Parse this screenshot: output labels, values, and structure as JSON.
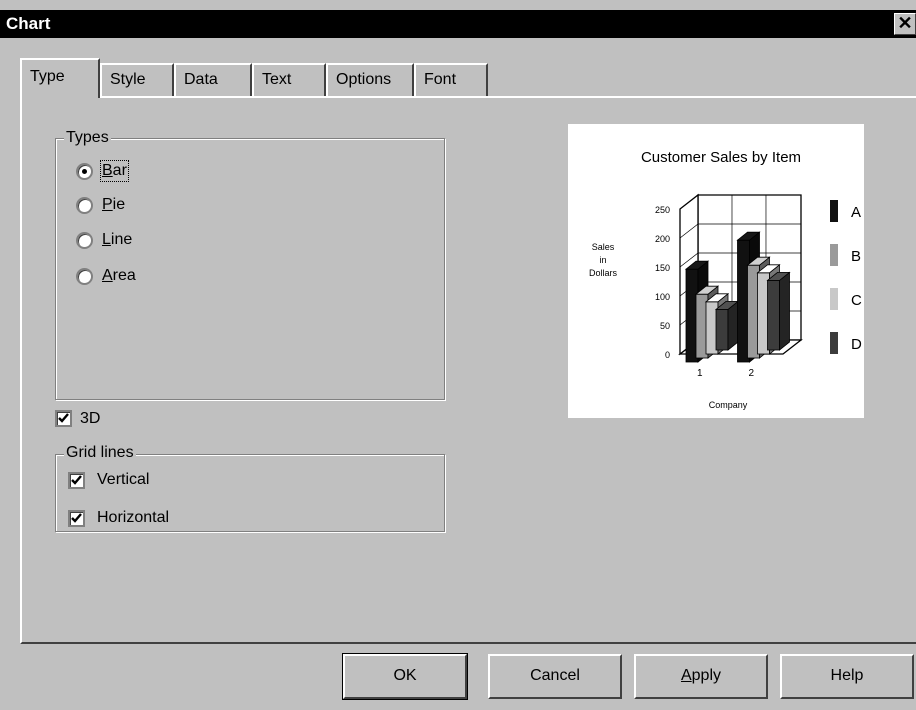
{
  "window": {
    "title": "Chart",
    "close_glyph": "✕"
  },
  "tabs": [
    {
      "label": "Type",
      "active": true
    },
    {
      "label": "Style"
    },
    {
      "label": "Data"
    },
    {
      "label": "Text"
    },
    {
      "label": "Options"
    },
    {
      "label": "Font"
    }
  ],
  "types_group": {
    "title": "Types",
    "options": [
      {
        "mnemonic": "B",
        "rest": "ar",
        "selected": true
      },
      {
        "mnemonic": "P",
        "rest": "ie",
        "selected": false
      },
      {
        "mnemonic": "L",
        "rest": "ine",
        "selected": false
      },
      {
        "mnemonic": "A",
        "rest": "rea",
        "selected": false
      }
    ]
  },
  "three_d": {
    "label": "3D",
    "checked": true
  },
  "grid_lines": {
    "title": "Grid lines",
    "vertical": {
      "label": "Vertical",
      "checked": true
    },
    "horizontal": {
      "label": "Horizontal",
      "checked": true
    }
  },
  "chart_data": {
    "type": "bar",
    "title": "Customer Sales by Item",
    "xlabel": "Company",
    "ylabel_lines": [
      "Sales",
      "in",
      "Dollars"
    ],
    "categories": [
      "1",
      "2"
    ],
    "yticks": [
      "250",
      "200",
      "150",
      "100",
      "50",
      "0"
    ],
    "ylim": [
      0,
      250
    ],
    "three_d": true,
    "grid": true,
    "legend_position": "right",
    "series": [
      {
        "name": "A",
        "values": [
          160,
          210
        ],
        "color": "#111111"
      },
      {
        "name": "B",
        "values": [
          110,
          160
        ],
        "color": "#9a9a9a"
      },
      {
        "name": "C",
        "values": [
          90,
          140
        ],
        "color": "#c8c8c8"
      },
      {
        "name": "D",
        "values": [
          70,
          120
        ],
        "color": "#3c3c3c"
      }
    ]
  },
  "buttons": {
    "ok": "OK",
    "cancel": "Cancel",
    "apply": {
      "mnemonic": "A",
      "rest": "pply"
    },
    "help": "Help"
  },
  "colors": {
    "face": "#c0c0c0",
    "shadow": "#808080",
    "highlight": "#ffffff",
    "title_bg": "#000000"
  }
}
